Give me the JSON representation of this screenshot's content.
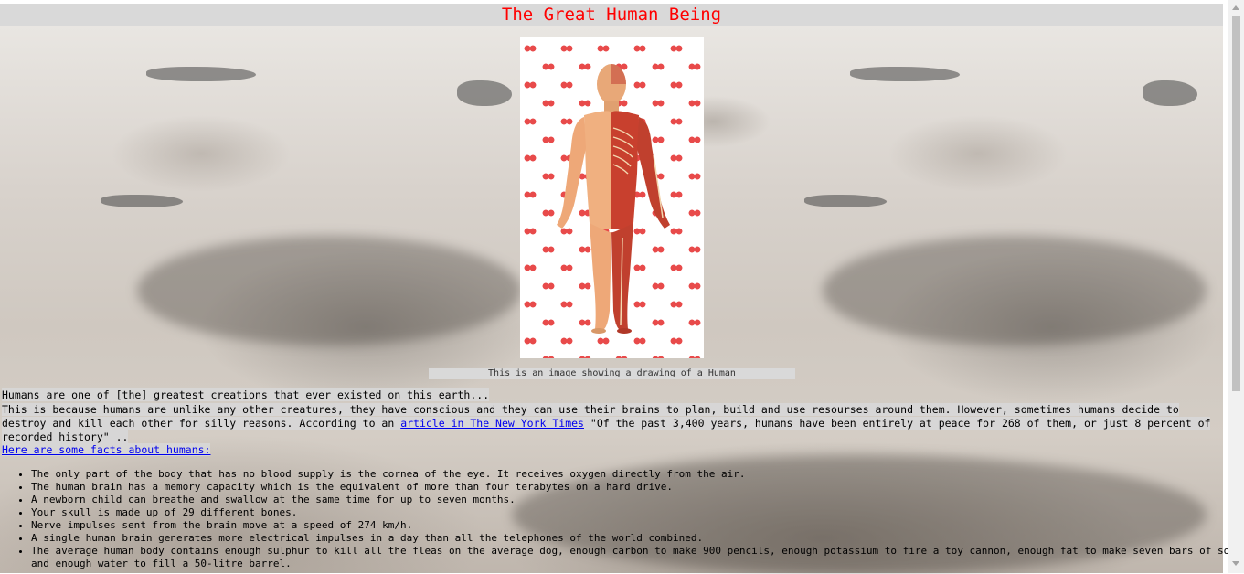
{
  "page": {
    "title": "The Great Human Being"
  },
  "image": {
    "caption": "This is an image showing a drawing of a Human"
  },
  "content": {
    "intro": "Humans are one of [the] greatest creations that ever existed on this earth...",
    "paragraph_before_link": "This is because humans are unlike any other creatures, they have conscious and they can use their brains to plan, build and use resourses around them. However, sometimes humans decide to destroy and kill each other for silly reasons. According to an ",
    "link_text": "article in The New York Times",
    "paragraph_after_link": " \"Of the past 3,400 years, humans have been entirely at peace for 268 of them, or just 8 percent of recorded history\" ..",
    "facts_heading": "Here are some facts about humans: ",
    "facts": [
      "The only part of the body that has no blood supply is the cornea of the eye. It receives oxygen directly from the air.",
      "The human brain has a memory capacity which is the equivalent of more than four terabytes on a hard drive.",
      "A newborn child can breathe and swallow at the same time for up to seven months.",
      "Your skull is made up of 29 different bones.",
      "Nerve impulses sent from the brain move at a speed of 274 km/h.",
      "A single human brain generates more electrical impulses in a day than all the telephones of the world combined.",
      "The average human body contains enough sulphur to kill all the fleas on the average dog, enough carbon to make 900 pencils, enough potassium to fire a toy cannon, enough fat to make seven bars of soap and enough water to fill a 50-litre barrel."
    ]
  },
  "colors": {
    "title": "#ff0000",
    "highlight": "#d9d9d9",
    "link": "#0000ee"
  }
}
